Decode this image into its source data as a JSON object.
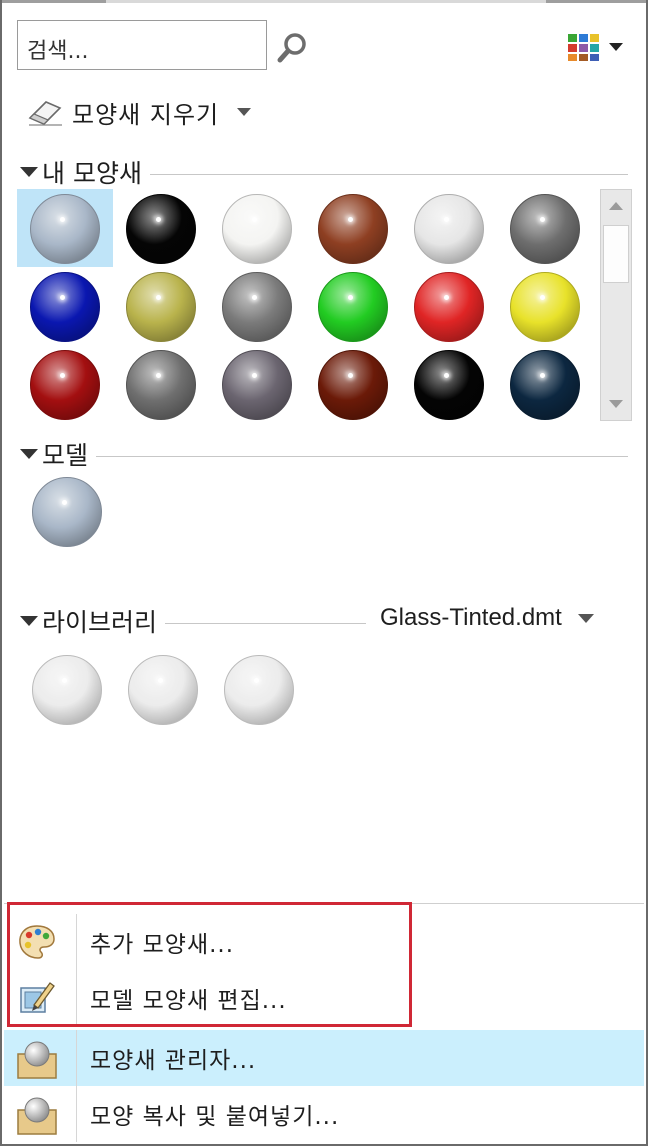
{
  "search": {
    "placeholder": "검색..."
  },
  "view_toggle_icon": "view-grid-icon",
  "clear_button": {
    "label": "모양새 지우기"
  },
  "sections": {
    "my_appearances": "내 모양새",
    "model": "모델",
    "library": "라이브러리"
  },
  "library_file": "Glass-Tinted.dmt",
  "my_appearance_swatches": [
    {
      "color": "#a9b7c8",
      "selected": true
    },
    {
      "color": "#050505",
      "selected": false
    },
    {
      "color": "#f4f4f2",
      "selected": false
    },
    {
      "color": "#8e3f22",
      "selected": false
    },
    {
      "color": "#e6e6e6",
      "selected": false
    },
    {
      "color": "#6e6e6e",
      "selected": false
    },
    {
      "color": "#0a17b0",
      "selected": false
    },
    {
      "color": "#b9b34c",
      "selected": false
    },
    {
      "color": "#7b7b7b",
      "selected": false
    },
    {
      "color": "#22cc22",
      "selected": false
    },
    {
      "color": "#e02525",
      "selected": false
    },
    {
      "color": "#e8e22a",
      "selected": false
    },
    {
      "color": "#a30f10",
      "selected": false
    },
    {
      "color": "#6f6f6f",
      "selected": false
    },
    {
      "color": "#6b6570",
      "selected": false
    },
    {
      "color": "#6b1a08",
      "selected": false
    },
    {
      "color": "#040404",
      "selected": false
    },
    {
      "color": "#0c2740",
      "selected": false
    }
  ],
  "model_swatches": [
    {
      "color": "#a9b7c8"
    }
  ],
  "library_swatches": [
    {
      "color": "#e9e9e9"
    },
    {
      "color": "#e9e9e9"
    },
    {
      "color": "#e9e9e9"
    }
  ],
  "menu": [
    {
      "label": "추가 모양새...",
      "icon": "palette-icon",
      "highlighted": false
    },
    {
      "label": "모델 모양새 편집...",
      "icon": "edit-appearance-icon",
      "highlighted": false
    },
    {
      "label": "모양새 관리자...",
      "icon": "appearance-manager-icon",
      "highlighted": true
    },
    {
      "label": "모양 복사 및 붙여넣기...",
      "icon": "copy-paste-appearance-icon",
      "highlighted": false
    }
  ],
  "annotation_color": "#d02835"
}
